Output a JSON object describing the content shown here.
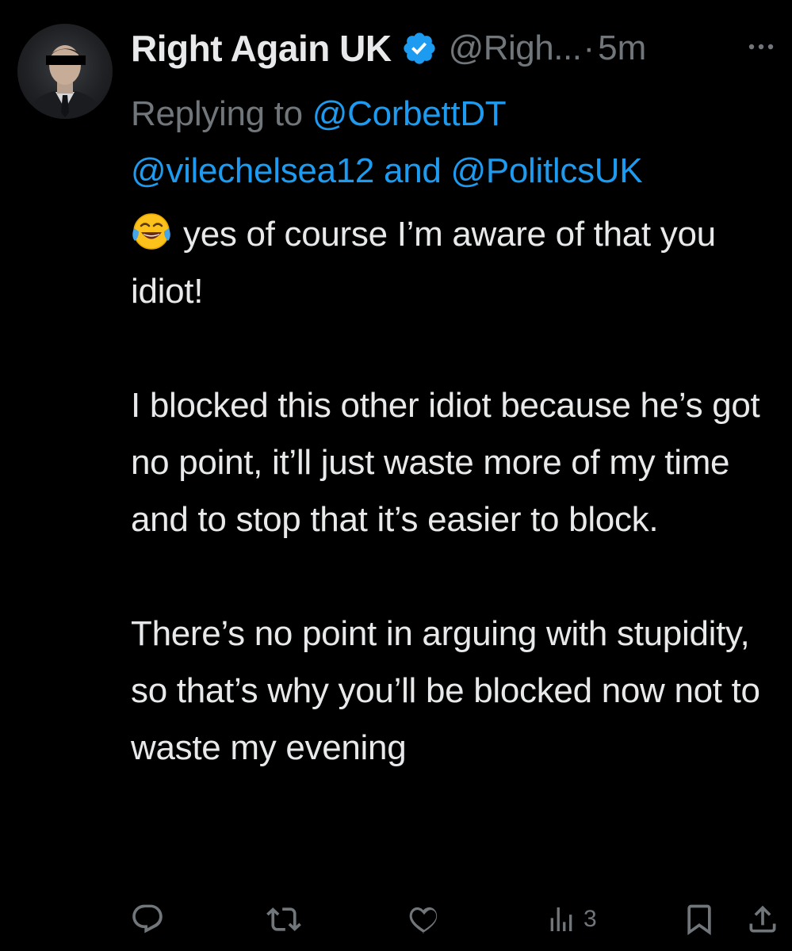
{
  "tweet": {
    "display_name": "Right Again UK",
    "handle": "@Righ...",
    "separator": "·",
    "time": "5m",
    "replying_prefix": "Replying to ",
    "mentions": [
      "@CorbettDT",
      "@vilechelsea12",
      "@PolitlcsUK"
    ],
    "and_word": " and ",
    "paragraphs": [
      "yes of course I’m aware of that you idiot!",
      "I blocked this other idiot because he’s got no point, it’ll just waste more of my time and to stop that it’s easier to block.",
      "There’s no point in arguing with stupidity, so that’s why you’ll be blocked now not to waste my evening"
    ],
    "views_count": "3"
  },
  "icons": {
    "verified": "verified-badge-icon",
    "more": "more-options-icon",
    "reply": "reply-icon",
    "retweet": "retweet-icon",
    "like": "like-icon",
    "views": "views-icon",
    "bookmark": "bookmark-icon",
    "share": "share-icon",
    "emoji": "face-with-tears-of-joy-emoji"
  },
  "colors": {
    "background": "#000000",
    "text": "#e7e9ea",
    "muted": "#71767b",
    "link": "#1d9bf0",
    "verified": "#1d9bf0"
  }
}
